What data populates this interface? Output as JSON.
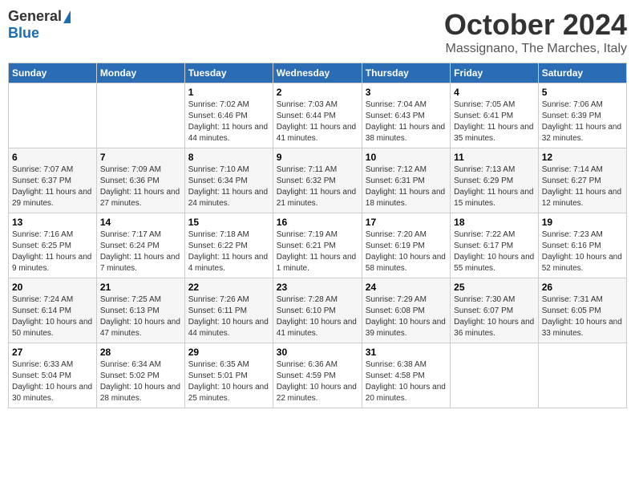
{
  "logo": {
    "general": "General",
    "blue": "Blue"
  },
  "header": {
    "month": "October 2024",
    "location": "Massignano, The Marches, Italy"
  },
  "weekdays": [
    "Sunday",
    "Monday",
    "Tuesday",
    "Wednesday",
    "Thursday",
    "Friday",
    "Saturday"
  ],
  "weeks": [
    [
      {
        "day": "",
        "sunrise": "",
        "sunset": "",
        "daylight": ""
      },
      {
        "day": "",
        "sunrise": "",
        "sunset": "",
        "daylight": ""
      },
      {
        "day": "1",
        "sunrise": "Sunrise: 7:02 AM",
        "sunset": "Sunset: 6:46 PM",
        "daylight": "Daylight: 11 hours and 44 minutes."
      },
      {
        "day": "2",
        "sunrise": "Sunrise: 7:03 AM",
        "sunset": "Sunset: 6:44 PM",
        "daylight": "Daylight: 11 hours and 41 minutes."
      },
      {
        "day": "3",
        "sunrise": "Sunrise: 7:04 AM",
        "sunset": "Sunset: 6:43 PM",
        "daylight": "Daylight: 11 hours and 38 minutes."
      },
      {
        "day": "4",
        "sunrise": "Sunrise: 7:05 AM",
        "sunset": "Sunset: 6:41 PM",
        "daylight": "Daylight: 11 hours and 35 minutes."
      },
      {
        "day": "5",
        "sunrise": "Sunrise: 7:06 AM",
        "sunset": "Sunset: 6:39 PM",
        "daylight": "Daylight: 11 hours and 32 minutes."
      }
    ],
    [
      {
        "day": "6",
        "sunrise": "Sunrise: 7:07 AM",
        "sunset": "Sunset: 6:37 PM",
        "daylight": "Daylight: 11 hours and 29 minutes."
      },
      {
        "day": "7",
        "sunrise": "Sunrise: 7:09 AM",
        "sunset": "Sunset: 6:36 PM",
        "daylight": "Daylight: 11 hours and 27 minutes."
      },
      {
        "day": "8",
        "sunrise": "Sunrise: 7:10 AM",
        "sunset": "Sunset: 6:34 PM",
        "daylight": "Daylight: 11 hours and 24 minutes."
      },
      {
        "day": "9",
        "sunrise": "Sunrise: 7:11 AM",
        "sunset": "Sunset: 6:32 PM",
        "daylight": "Daylight: 11 hours and 21 minutes."
      },
      {
        "day": "10",
        "sunrise": "Sunrise: 7:12 AM",
        "sunset": "Sunset: 6:31 PM",
        "daylight": "Daylight: 11 hours and 18 minutes."
      },
      {
        "day": "11",
        "sunrise": "Sunrise: 7:13 AM",
        "sunset": "Sunset: 6:29 PM",
        "daylight": "Daylight: 11 hours and 15 minutes."
      },
      {
        "day": "12",
        "sunrise": "Sunrise: 7:14 AM",
        "sunset": "Sunset: 6:27 PM",
        "daylight": "Daylight: 11 hours and 12 minutes."
      }
    ],
    [
      {
        "day": "13",
        "sunrise": "Sunrise: 7:16 AM",
        "sunset": "Sunset: 6:25 PM",
        "daylight": "Daylight: 11 hours and 9 minutes."
      },
      {
        "day": "14",
        "sunrise": "Sunrise: 7:17 AM",
        "sunset": "Sunset: 6:24 PM",
        "daylight": "Daylight: 11 hours and 7 minutes."
      },
      {
        "day": "15",
        "sunrise": "Sunrise: 7:18 AM",
        "sunset": "Sunset: 6:22 PM",
        "daylight": "Daylight: 11 hours and 4 minutes."
      },
      {
        "day": "16",
        "sunrise": "Sunrise: 7:19 AM",
        "sunset": "Sunset: 6:21 PM",
        "daylight": "Daylight: 11 hours and 1 minute."
      },
      {
        "day": "17",
        "sunrise": "Sunrise: 7:20 AM",
        "sunset": "Sunset: 6:19 PM",
        "daylight": "Daylight: 10 hours and 58 minutes."
      },
      {
        "day": "18",
        "sunrise": "Sunrise: 7:22 AM",
        "sunset": "Sunset: 6:17 PM",
        "daylight": "Daylight: 10 hours and 55 minutes."
      },
      {
        "day": "19",
        "sunrise": "Sunrise: 7:23 AM",
        "sunset": "Sunset: 6:16 PM",
        "daylight": "Daylight: 10 hours and 52 minutes."
      }
    ],
    [
      {
        "day": "20",
        "sunrise": "Sunrise: 7:24 AM",
        "sunset": "Sunset: 6:14 PM",
        "daylight": "Daylight: 10 hours and 50 minutes."
      },
      {
        "day": "21",
        "sunrise": "Sunrise: 7:25 AM",
        "sunset": "Sunset: 6:13 PM",
        "daylight": "Daylight: 10 hours and 47 minutes."
      },
      {
        "day": "22",
        "sunrise": "Sunrise: 7:26 AM",
        "sunset": "Sunset: 6:11 PM",
        "daylight": "Daylight: 10 hours and 44 minutes."
      },
      {
        "day": "23",
        "sunrise": "Sunrise: 7:28 AM",
        "sunset": "Sunset: 6:10 PM",
        "daylight": "Daylight: 10 hours and 41 minutes."
      },
      {
        "day": "24",
        "sunrise": "Sunrise: 7:29 AM",
        "sunset": "Sunset: 6:08 PM",
        "daylight": "Daylight: 10 hours and 39 minutes."
      },
      {
        "day": "25",
        "sunrise": "Sunrise: 7:30 AM",
        "sunset": "Sunset: 6:07 PM",
        "daylight": "Daylight: 10 hours and 36 minutes."
      },
      {
        "day": "26",
        "sunrise": "Sunrise: 7:31 AM",
        "sunset": "Sunset: 6:05 PM",
        "daylight": "Daylight: 10 hours and 33 minutes."
      }
    ],
    [
      {
        "day": "27",
        "sunrise": "Sunrise: 6:33 AM",
        "sunset": "Sunset: 5:04 PM",
        "daylight": "Daylight: 10 hours and 30 minutes."
      },
      {
        "day": "28",
        "sunrise": "Sunrise: 6:34 AM",
        "sunset": "Sunset: 5:02 PM",
        "daylight": "Daylight: 10 hours and 28 minutes."
      },
      {
        "day": "29",
        "sunrise": "Sunrise: 6:35 AM",
        "sunset": "Sunset: 5:01 PM",
        "daylight": "Daylight: 10 hours and 25 minutes."
      },
      {
        "day": "30",
        "sunrise": "Sunrise: 6:36 AM",
        "sunset": "Sunset: 4:59 PM",
        "daylight": "Daylight: 10 hours and 22 minutes."
      },
      {
        "day": "31",
        "sunrise": "Sunrise: 6:38 AM",
        "sunset": "Sunset: 4:58 PM",
        "daylight": "Daylight: 10 hours and 20 minutes."
      },
      {
        "day": "",
        "sunrise": "",
        "sunset": "",
        "daylight": ""
      },
      {
        "day": "",
        "sunrise": "",
        "sunset": "",
        "daylight": ""
      }
    ]
  ]
}
